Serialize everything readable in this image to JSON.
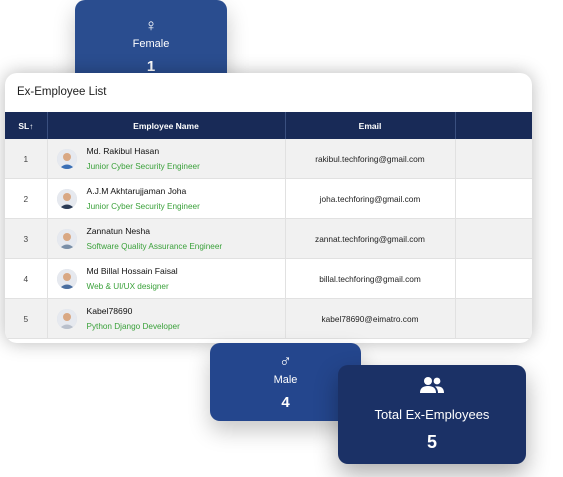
{
  "stats": {
    "female": {
      "icon": "female-icon",
      "symbol": "♀",
      "label": "Female",
      "value": "1"
    },
    "male": {
      "icon": "male-icon",
      "symbol": "♂",
      "label": "Male",
      "value": "4"
    },
    "total": {
      "icon": "users-icon",
      "label": "Total Ex-Employees",
      "value": "5"
    }
  },
  "table": {
    "title": "Ex-Employee List",
    "headers": {
      "sl": "SL",
      "sort_icon": "↑",
      "name": "Employee Name",
      "email": "Email",
      "position": ""
    },
    "rows": [
      {
        "sl": "1",
        "name": "Md. Rakibul Hasan",
        "role": "Junior Cyber Security Engineer",
        "email": "rakibul.techforing@gmail.com",
        "position": "Junior Cyb",
        "avatar_color": "#3a6fb5"
      },
      {
        "sl": "2",
        "name": "A.J.M Akhtarujjaman Joha",
        "role": "Junior Cyber Security Engineer",
        "email": "joha.techforing@gmail.com",
        "position": "Junior Cyb",
        "avatar_color": "#2a3a55"
      },
      {
        "sl": "3",
        "name": "Zannatun Nesha",
        "role": "Software Quality Assurance Engineer",
        "email": "zannat.techforing@gmail.com",
        "position": "Software Qu",
        "avatar_color": "#7a8fa8"
      },
      {
        "sl": "4",
        "name": "Md Billal Hossain Faisal",
        "role": "Web & UI/UX designer",
        "email": "billal.techforing@gmail.com",
        "position": "Web &",
        "avatar_color": "#4b6fa0"
      },
      {
        "sl": "5",
        "name": "Kabel78690",
        "role": "Python Django Developer",
        "email": "kabel78690@eimatro.com",
        "position": "Python",
        "avatar_color": "#b9c0cc"
      }
    ]
  }
}
